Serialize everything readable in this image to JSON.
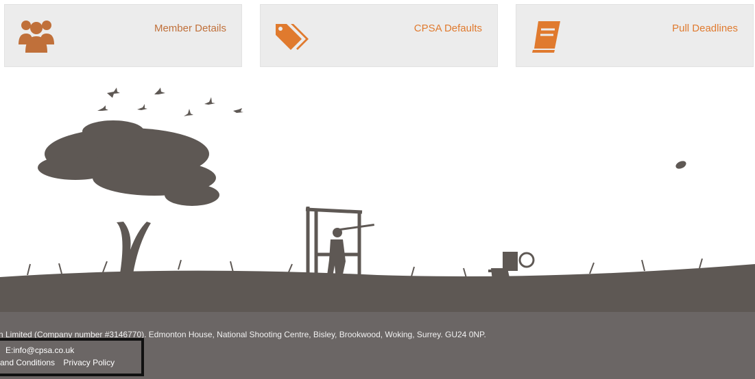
{
  "cards": [
    {
      "label": "Member Details",
      "icon": "users-icon",
      "color": "#c0703a"
    },
    {
      "label": "CPSA Defaults",
      "icon": "tags-icon",
      "color": "#e07a2e"
    },
    {
      "label": "Pull Deadlines",
      "icon": "book-icon",
      "color": "#e07a2e"
    }
  ],
  "footer": {
    "company_text": "n Limited (Company number #3146770). Edmonton House, National Shooting Centre, Bisley, Brookwood, Woking, Surrey. GU24 0NP.",
    "email": "E:info@cpsa.co.uk",
    "links": [
      "and Conditions",
      "Privacy Policy"
    ]
  },
  "colors": {
    "accent": "#e07a2e",
    "silhouette": "#5e5854",
    "footer_bg": "#6b6665",
    "card_bg": "#ececec"
  }
}
